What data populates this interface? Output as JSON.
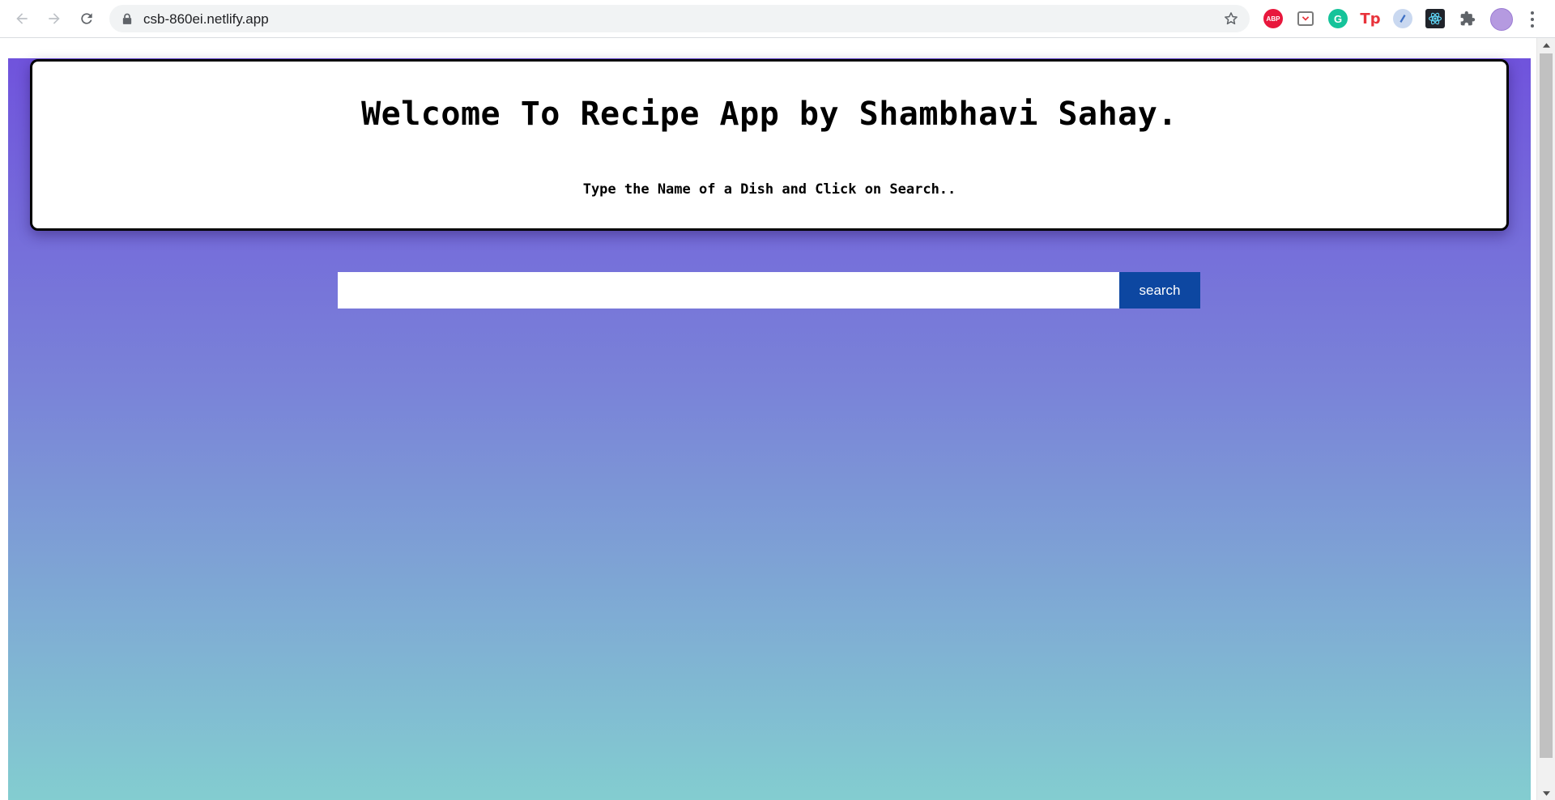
{
  "browser": {
    "url": "csb-860ei.netlify.app",
    "extensions": [
      {
        "name": "adblock-plus-icon",
        "label": "ABP"
      },
      {
        "name": "pocket-icon",
        "label": ""
      },
      {
        "name": "grammarly-icon",
        "label": "G"
      },
      {
        "name": "tp-icon",
        "label": "Tp"
      },
      {
        "name": "o-extension-icon",
        "label": ""
      },
      {
        "name": "react-devtools-icon",
        "label": ""
      },
      {
        "name": "extensions-puzzle-icon",
        "label": ""
      }
    ]
  },
  "header": {
    "title": "Welcome To Recipe App by Shambhavi Sahay.",
    "subtitle": "Type the Name of a Dish and Click on Search.."
  },
  "search": {
    "value": "",
    "placeholder": "",
    "button_label": "search"
  },
  "colors": {
    "gradient_top": "#7053dc",
    "gradient_bottom": "#83cdd0",
    "button": "#0d47a1"
  }
}
